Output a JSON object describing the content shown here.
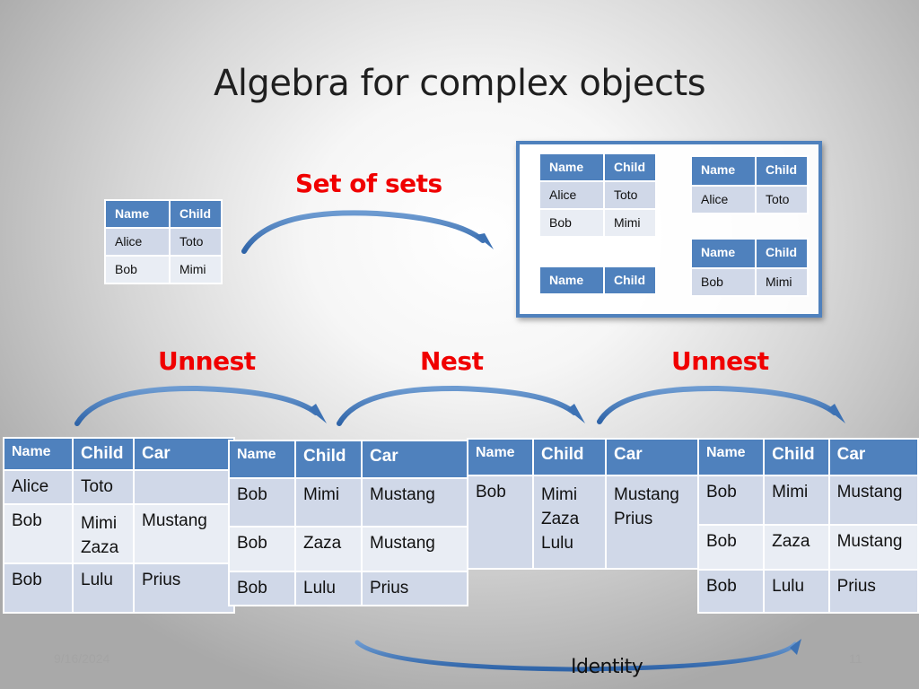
{
  "title": "Algebra for complex objects",
  "labels": {
    "set_of_sets": "Set of sets",
    "unnest_left": "Unnest",
    "nest": "Nest",
    "unnest_right": "Unnest",
    "identity": "Identity"
  },
  "footer": {
    "date": "9/16/2024",
    "page": "11"
  },
  "colors": {
    "header": "#4f81bd",
    "row": "#d0d8e8",
    "row_alt": "#e9edf4",
    "label": "#f00000",
    "arrow": "#3d72b4"
  },
  "flat_table": {
    "headers": [
      "Name",
      "Child"
    ],
    "rows": [
      [
        "Alice",
        "Toto"
      ],
      [
        "Bob",
        "Mimi"
      ]
    ]
  },
  "set_of_sets": {
    "outer": {
      "headers": [
        "Name",
        "Child"
      ],
      "rows": [
        [
          "Alice",
          "Toto"
        ],
        [
          "Bob",
          "Mimi"
        ]
      ]
    },
    "empty": {
      "headers": [
        "Name",
        "Child"
      ]
    },
    "alice": {
      "headers": [
        "Name",
        "Child"
      ],
      "rows": [
        [
          "Alice",
          "Toto"
        ]
      ]
    },
    "bob": {
      "headers": [
        "Name",
        "Child"
      ],
      "rows": [
        [
          "Bob",
          "Mimi"
        ]
      ]
    }
  },
  "nested_table_1": {
    "headers": [
      "Name",
      "Child",
      "Car"
    ],
    "rows": [
      [
        "Alice",
        "Toto",
        ""
      ],
      [
        "Bob",
        "Mimi\nZaza",
        "Mustang"
      ],
      [
        "Bob",
        "Lulu",
        "Prius"
      ]
    ]
  },
  "flat_table_2": {
    "headers": [
      "Name",
      "Child",
      "Car"
    ],
    "rows": [
      [
        "Bob",
        "Mimi",
        "Mustang"
      ],
      [
        "Bob",
        "Zaza",
        "Mustang"
      ],
      [
        "Bob",
        "Lulu",
        "Prius"
      ]
    ]
  },
  "nested_table_2": {
    "headers": [
      "Name",
      "Child",
      "Car"
    ],
    "rows": [
      [
        "Bob",
        "Mimi\nZaza\nLulu",
        "Mustang\nPrius"
      ]
    ]
  },
  "flat_table_3": {
    "headers": [
      "Name",
      "Child",
      "Car"
    ],
    "rows": [
      [
        "Bob",
        "Mimi",
        "Mustang"
      ],
      [
        "Bob",
        "Zaza",
        "Mustang"
      ],
      [
        "Bob",
        "Lulu",
        "Prius"
      ]
    ]
  }
}
